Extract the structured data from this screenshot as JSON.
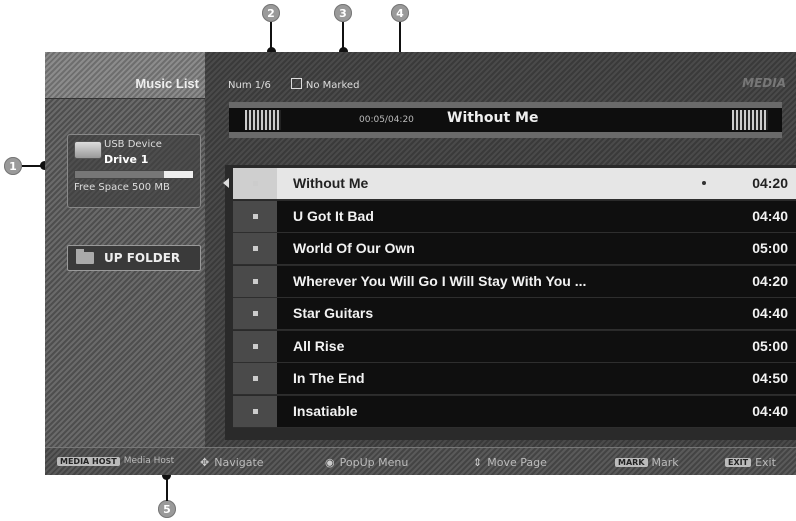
{
  "callouts": [
    "1",
    "2",
    "3",
    "4",
    "5"
  ],
  "sidebar": {
    "title": "Music List",
    "device": {
      "type": "USB Device",
      "name": "Drive 1",
      "free_space": "Free Space 500 MB",
      "usage_fraction": 0.75
    },
    "up_folder_label": "UP FOLDER"
  },
  "header": {
    "num": "Num 1/6",
    "marked": "No Marked",
    "brand": "MEDIA"
  },
  "now_playing": {
    "time": "00:05/04:20",
    "title": "Without Me"
  },
  "tracks": [
    {
      "title": "Without Me",
      "time": "04:20",
      "selected": true
    },
    {
      "title": "U Got It Bad",
      "time": "04:40",
      "selected": false
    },
    {
      "title": "World Of Our Own",
      "time": "05:00",
      "selected": false
    },
    {
      "title": "Wherever You Will Go I Will Stay With You ...",
      "time": "04:20",
      "selected": false
    },
    {
      "title": "Star Guitars",
      "time": "04:40",
      "selected": false
    },
    {
      "title": "All Rise",
      "time": "05:00",
      "selected": false
    },
    {
      "title": "In The End",
      "time": "04:50",
      "selected": false
    },
    {
      "title": "Insatiable",
      "time": "04:40",
      "selected": false
    }
  ],
  "footer": {
    "media_host_key": "MEDIA HOST",
    "media_host_label": "Media Host",
    "navigate_label": "Navigate",
    "popup_label": "PopUp Menu",
    "move_page_label": "Move Page",
    "mark_key": "MARK",
    "mark_label": "Mark",
    "exit_key": "EXIT",
    "exit_label": "Exit"
  }
}
